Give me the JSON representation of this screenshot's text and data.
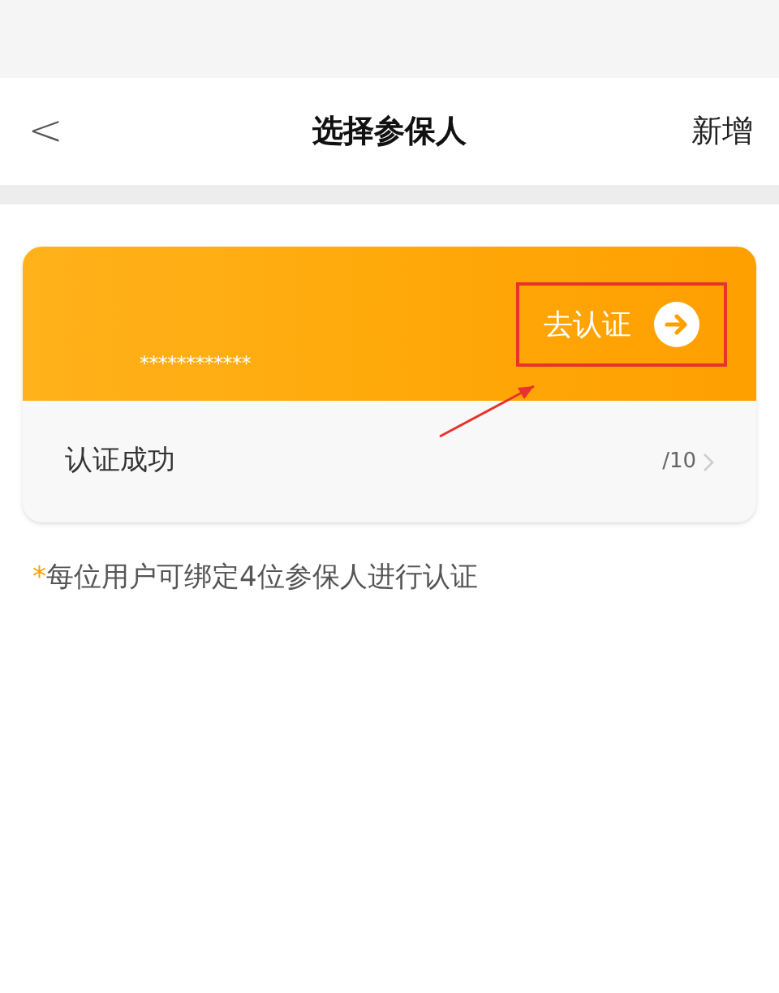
{
  "nav": {
    "back": "<",
    "title": "选择参保人",
    "action": "新增"
  },
  "card": {
    "masked_id": "************",
    "verify_button": "去认证",
    "status": "认证成功",
    "count": "/10"
  },
  "note": {
    "mark": "*",
    "text": "每位用户可绑定4位参保人进行认证"
  }
}
